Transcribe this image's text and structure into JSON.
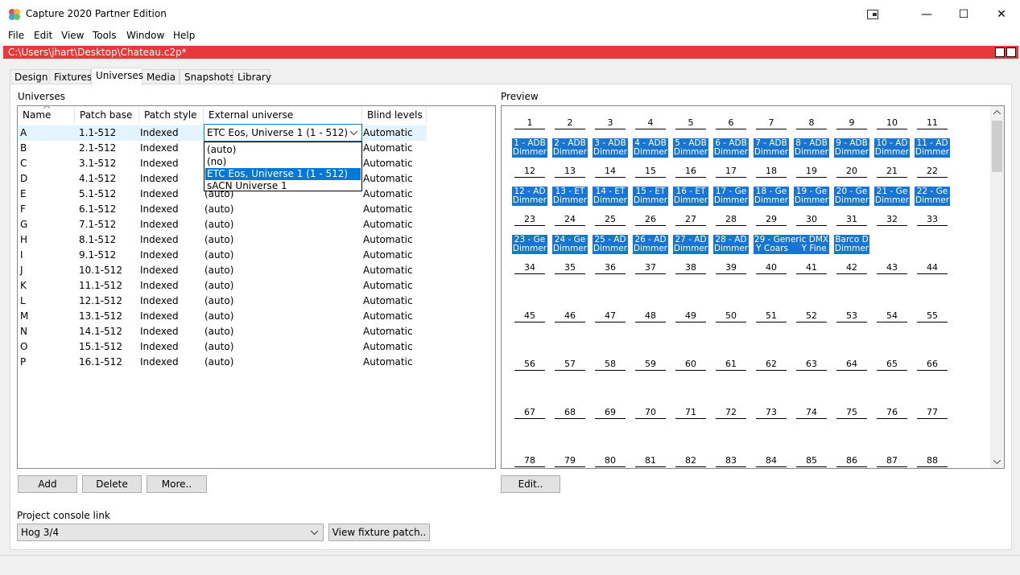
{
  "window": {
    "title": "Capture 2020 Partner Edition",
    "controls": [
      "minimize",
      "maximize",
      "close"
    ]
  },
  "menu": [
    "File",
    "Edit",
    "View",
    "Tools",
    "Window",
    "Help"
  ],
  "path": "C:\\Users\\jhart\\Desktop\\Chateau.c2p*",
  "tabs": [
    "Design",
    "Fixtures",
    "Universes",
    "Media",
    "Snapshots",
    "Library"
  ],
  "active_tab": "Universes",
  "universes": {
    "label": "Universes",
    "columns": [
      "Name",
      "Patch base",
      "Patch style",
      "External universe",
      "Blind levels"
    ],
    "rows": [
      {
        "name": "A",
        "base": "1.1-512",
        "style": "Indexed",
        "ext": "ETC Eos, Universe 1 (1 - 512)",
        "blind": "Automatic"
      },
      {
        "name": "B",
        "base": "2.1-512",
        "style": "Indexed",
        "ext": "(auto)",
        "blind": "Automatic"
      },
      {
        "name": "C",
        "base": "3.1-512",
        "style": "Indexed",
        "ext": "(auto)",
        "blind": "Automatic"
      },
      {
        "name": "D",
        "base": "4.1-512",
        "style": "Indexed",
        "ext": "(auto)",
        "blind": "Automatic"
      },
      {
        "name": "E",
        "base": "5.1-512",
        "style": "Indexed",
        "ext": "(auto)",
        "blind": "Automatic"
      },
      {
        "name": "F",
        "base": "6.1-512",
        "style": "Indexed",
        "ext": "(auto)",
        "blind": "Automatic"
      },
      {
        "name": "G",
        "base": "7.1-512",
        "style": "Indexed",
        "ext": "(auto)",
        "blind": "Automatic"
      },
      {
        "name": "H",
        "base": "8.1-512",
        "style": "Indexed",
        "ext": "(auto)",
        "blind": "Automatic"
      },
      {
        "name": "I",
        "base": "9.1-512",
        "style": "Indexed",
        "ext": "(auto)",
        "blind": "Automatic"
      },
      {
        "name": "J",
        "base": "10.1-512",
        "style": "Indexed",
        "ext": "(auto)",
        "blind": "Automatic"
      },
      {
        "name": "K",
        "base": "11.1-512",
        "style": "Indexed",
        "ext": "(auto)",
        "blind": "Automatic"
      },
      {
        "name": "L",
        "base": "12.1-512",
        "style": "Indexed",
        "ext": "(auto)",
        "blind": "Automatic"
      },
      {
        "name": "M",
        "base": "13.1-512",
        "style": "Indexed",
        "ext": "(auto)",
        "blind": "Automatic"
      },
      {
        "name": "N",
        "base": "14.1-512",
        "style": "Indexed",
        "ext": "(auto)",
        "blind": "Automatic"
      },
      {
        "name": "O",
        "base": "15.1-512",
        "style": "Indexed",
        "ext": "(auto)",
        "blind": "Automatic"
      },
      {
        "name": "P",
        "base": "16.1-512",
        "style": "Indexed",
        "ext": "(auto)",
        "blind": "Automatic"
      }
    ],
    "dropdown_options": [
      "(auto)",
      "(no)",
      "ETC Eos, Universe 1 (1 - 512)",
      "sACN Universe 1"
    ],
    "dropdown_selected": "ETC Eos, Universe 1 (1 - 512)"
  },
  "buttons": {
    "add": "Add",
    "delete": "Delete",
    "more": "More..",
    "edit": "Edit..",
    "view_patch": "View fixture patch.."
  },
  "preview": {
    "label": "Preview",
    "fixture_rows": [
      [
        {
          "l1": "1 - ADB",
          "l2": "Dimmer"
        },
        {
          "l1": "2 - ADB",
          "l2": "Dimmer"
        },
        {
          "l1": "3 - ADB",
          "l2": "Dimmer"
        },
        {
          "l1": "4 - ADB",
          "l2": "Dimmer"
        },
        {
          "l1": "5 - ADB",
          "l2": "Dimmer"
        },
        {
          "l1": "6 - ADB",
          "l2": "Dimmer"
        },
        {
          "l1": "7 - ADB",
          "l2": "Dimmer"
        },
        {
          "l1": "8 - ADB",
          "l2": "Dimmer"
        },
        {
          "l1": "9 - ADB",
          "l2": "Dimmer"
        },
        {
          "l1": "10 - AD",
          "l2": "Dimmer"
        },
        {
          "l1": "11 - AD",
          "l2": "Dimmer"
        }
      ],
      [
        {
          "l1": "12 - AD",
          "l2": "Dimmer"
        },
        {
          "l1": "13 - ET",
          "l2": "Dimmer"
        },
        {
          "l1": "14 - ET",
          "l2": "Dimmer"
        },
        {
          "l1": "15 - ET",
          "l2": "Dimmer"
        },
        {
          "l1": "16 - ET",
          "l2": "Dimmer"
        },
        {
          "l1": "17 - Ge",
          "l2": "Dimmer"
        },
        {
          "l1": "18 - Ge",
          "l2": "Dimmer"
        },
        {
          "l1": "19 - Ge",
          "l2": "Dimmer"
        },
        {
          "l1": "20 - Ge",
          "l2": "Dimmer"
        },
        {
          "l1": "21 - Ge",
          "l2": "Dimmer"
        },
        {
          "l1": "22 - Ge",
          "l2": "Dimmer"
        }
      ],
      [
        {
          "l1": "23 - Ge",
          "l2": "Dimmer"
        },
        {
          "l1": "24 - Ge",
          "l2": "Dimmer"
        },
        {
          "l1": "25 - AD",
          "l2": "Dimmer"
        },
        {
          "l1": "26 - AD",
          "l2": "Dimmer"
        },
        {
          "l1": "27 - AD",
          "l2": "Dimmer"
        },
        {
          "l1": "28 - AD",
          "l2": "Dimmer"
        },
        {
          "l1": "29 - Generic DMX",
          "l2": "Y Coars     Y Fine",
          "wide": true
        },
        {
          "l1": "Barco D",
          "l2": "Dimmer"
        }
      ]
    ]
  },
  "console_link": {
    "label": "Project console link",
    "value": "Hog 3/4"
  }
}
